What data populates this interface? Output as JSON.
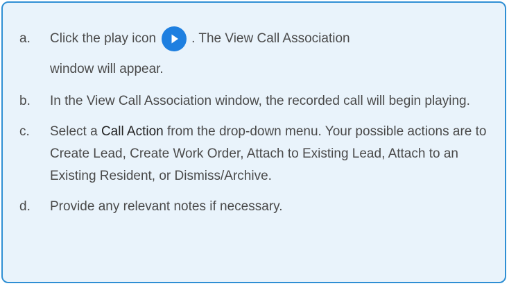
{
  "steps": [
    {
      "letter": "a.",
      "before_icon": "Click the play icon",
      "icon": "play-button-icon",
      "after_icon": ". The View Call Association",
      "continuation": "window will appear."
    },
    {
      "letter": "b.",
      "text": "In the View Call Association window, the recorded call will begin playing."
    },
    {
      "letter": "c.",
      "text_before": "Select a ",
      "emphasis": "Call Action",
      "text_after": " from the drop-down menu. Your possible actions are to Create Lead, Create Work Order, Attach to Existing Lead, Attach to an Existing Resident, or Dismiss/Archive."
    },
    {
      "letter": "d.",
      "text": "Provide any relevant notes if necessary."
    }
  ],
  "colors": {
    "border": "#2f8fd4",
    "background": "#e9f3fb",
    "text": "#4a4a4a",
    "icon": "#1e7fe0"
  }
}
